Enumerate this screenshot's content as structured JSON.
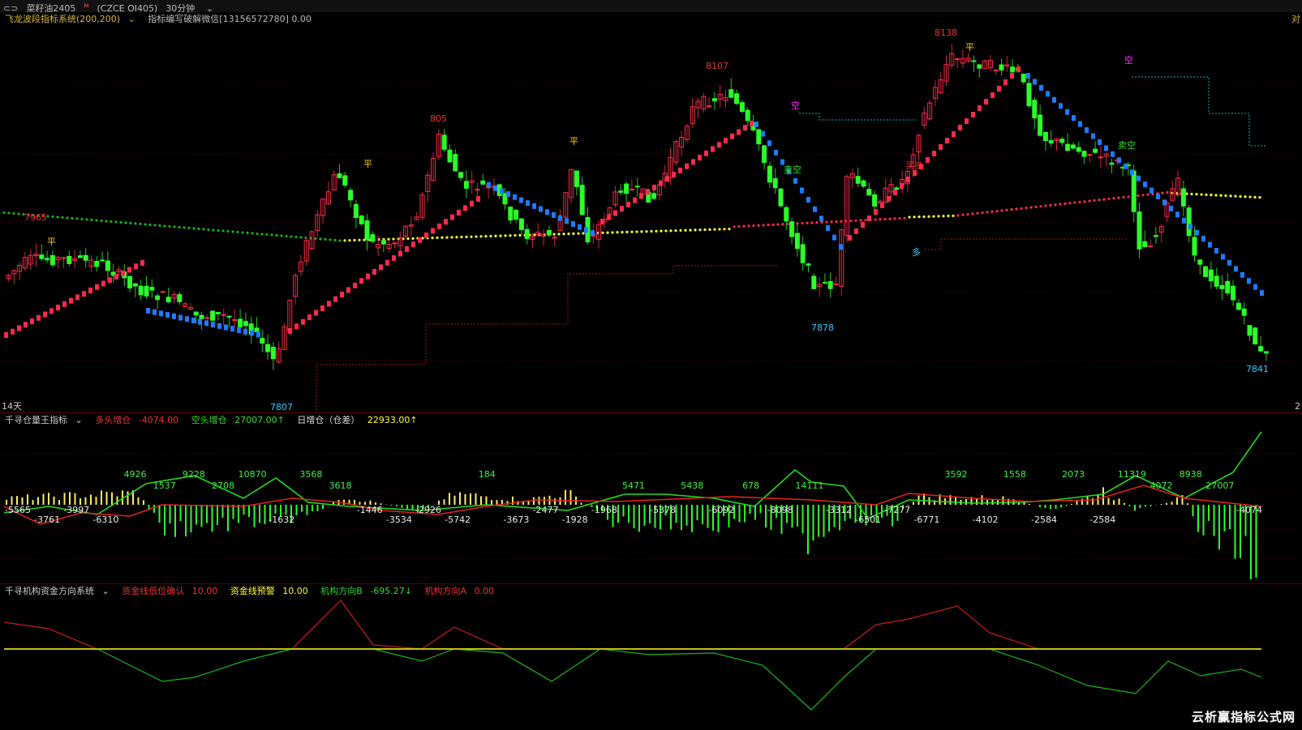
{
  "topbar": {
    "symbol": "菜籽油2405",
    "superscript": "M",
    "code": "(CZCE OI405)",
    "period": "30分钟"
  },
  "main_panel": {
    "indicator_name": "飞龙波段指标系统(200,200)",
    "indicator_note": "指标编写破解微信[13156572780] 0.00",
    "corner_right": "对",
    "axis_left_label": "14天",
    "axis_right_label": "2",
    "price_labels": [
      "7965",
      "805",
      "8107",
      "8138",
      "7807",
      "7878",
      "7841"
    ],
    "signal_labels": [
      "平",
      "平",
      "平",
      "平",
      "空",
      "空",
      "多",
      "卖空",
      "卖空",
      "买多"
    ]
  },
  "volume_panel": {
    "indicator_name": "千寻仓量王指标",
    "long_label": "多头增仓",
    "long_value": "-4074.00",
    "short_label": "空头增仓",
    "short_value": "27007.00↑",
    "daily_label": "日增仓（仓差）",
    "daily_value": "22933.00↑",
    "value_labels": [
      "-5565",
      "-3761",
      "-3997",
      "-6310",
      "4926",
      "1537",
      "9228",
      "2708",
      "10870",
      "-1632",
      "3568",
      "3618",
      "-1446",
      "-3534",
      "-2926",
      "-5742",
      "184",
      "-3673",
      "-2477",
      "-1928",
      "-1968",
      "5471",
      "-5378",
      "5438",
      "-6092",
      "678",
      "-8098",
      "14111",
      "-3312",
      "-6501",
      "-7277",
      "-6771",
      "3592",
      "-4102",
      "1558",
      "-2584",
      "2073",
      "-2584",
      "11319",
      "4072",
      "8938",
      "27007",
      "-4074"
    ]
  },
  "fund_panel": {
    "indicator_name": "千寻机构资金方向系统",
    "confirm_label": "资金线低位确认",
    "confirm_value": "10.00",
    "warn_label": "资金线预警",
    "warn_value": "10.00",
    "dir_b_label": "机构方向B",
    "dir_b_value": "-695.27↓",
    "dir_a_label": "机构方向A",
    "dir_a_value": "0.00"
  },
  "watermark": "云析赢指标公式网",
  "colors": {
    "up": "#ff2a4a",
    "down": "#2aff2a",
    "blue_trail": "#1e7bff",
    "red_trail": "#ff2a4a",
    "yellow_dots": "#ffff33",
    "green_dots": "#19b319",
    "baseline": "#ffa500",
    "fund_red": "#c81e1e",
    "fund_green": "#1eb41e"
  }
}
